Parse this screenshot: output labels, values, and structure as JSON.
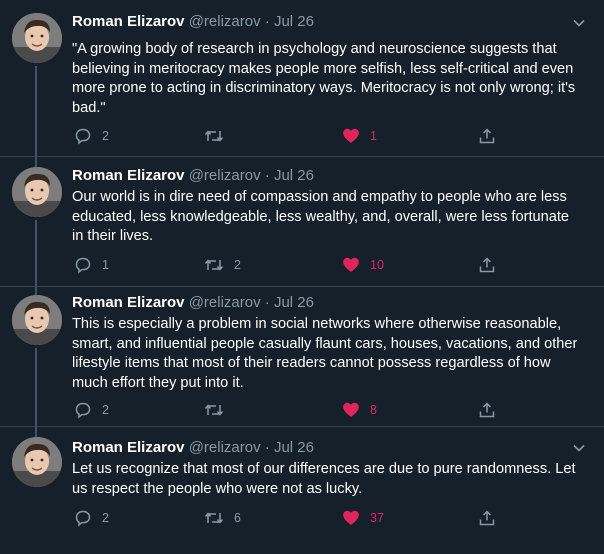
{
  "tweets": [
    {
      "name": "Roman Elizarov",
      "handle": "@relizarov",
      "date": "Jul 26",
      "text": "\"A growing body of research in psychology and neuroscience suggests that believing in meritocracy makes people more selfish, less self-critical and even more prone to acting in discriminatory ways. Meritocracy is not only wrong; it's bad.\"",
      "replies": "2",
      "retweets": "",
      "likes": "1",
      "liked": true
    },
    {
      "name": "Roman Elizarov",
      "handle": "@relizarov",
      "date": "Jul 26",
      "text": "Our world is in dire need of compassion and empathy to people who are less educated, less knowledgeable, less wealthy, and, overall, were less fortunate in their lives.",
      "replies": "1",
      "retweets": "2",
      "likes": "10",
      "liked": true
    },
    {
      "name": "Roman Elizarov",
      "handle": "@relizarov",
      "date": "Jul 26",
      "text": "This is especially a problem in social networks where otherwise reasonable, smart, and influential people casually flaunt cars, houses, vacations, and other lifestyle items that most of their readers cannot possess regardless of how much effort they put into it.",
      "replies": "2",
      "retweets": "",
      "likes": "8",
      "liked": true
    },
    {
      "name": "Roman Elizarov",
      "handle": "@relizarov",
      "date": "Jul 26",
      "text": "Let us recognize that most of our differences are due to pure randomness. Let us respect the people who were not as lucky.",
      "replies": "2",
      "retweets": "6",
      "likes": "37",
      "liked": true
    }
  ],
  "icons": {
    "reply": "reply-icon",
    "retweet": "retweet-icon",
    "like": "heart-icon",
    "share": "share-icon",
    "menu": "chevron-down-icon"
  },
  "colors": {
    "background": "#15202b",
    "muted": "#8899a6",
    "like": "#e0245e",
    "divider": "#38444d"
  }
}
